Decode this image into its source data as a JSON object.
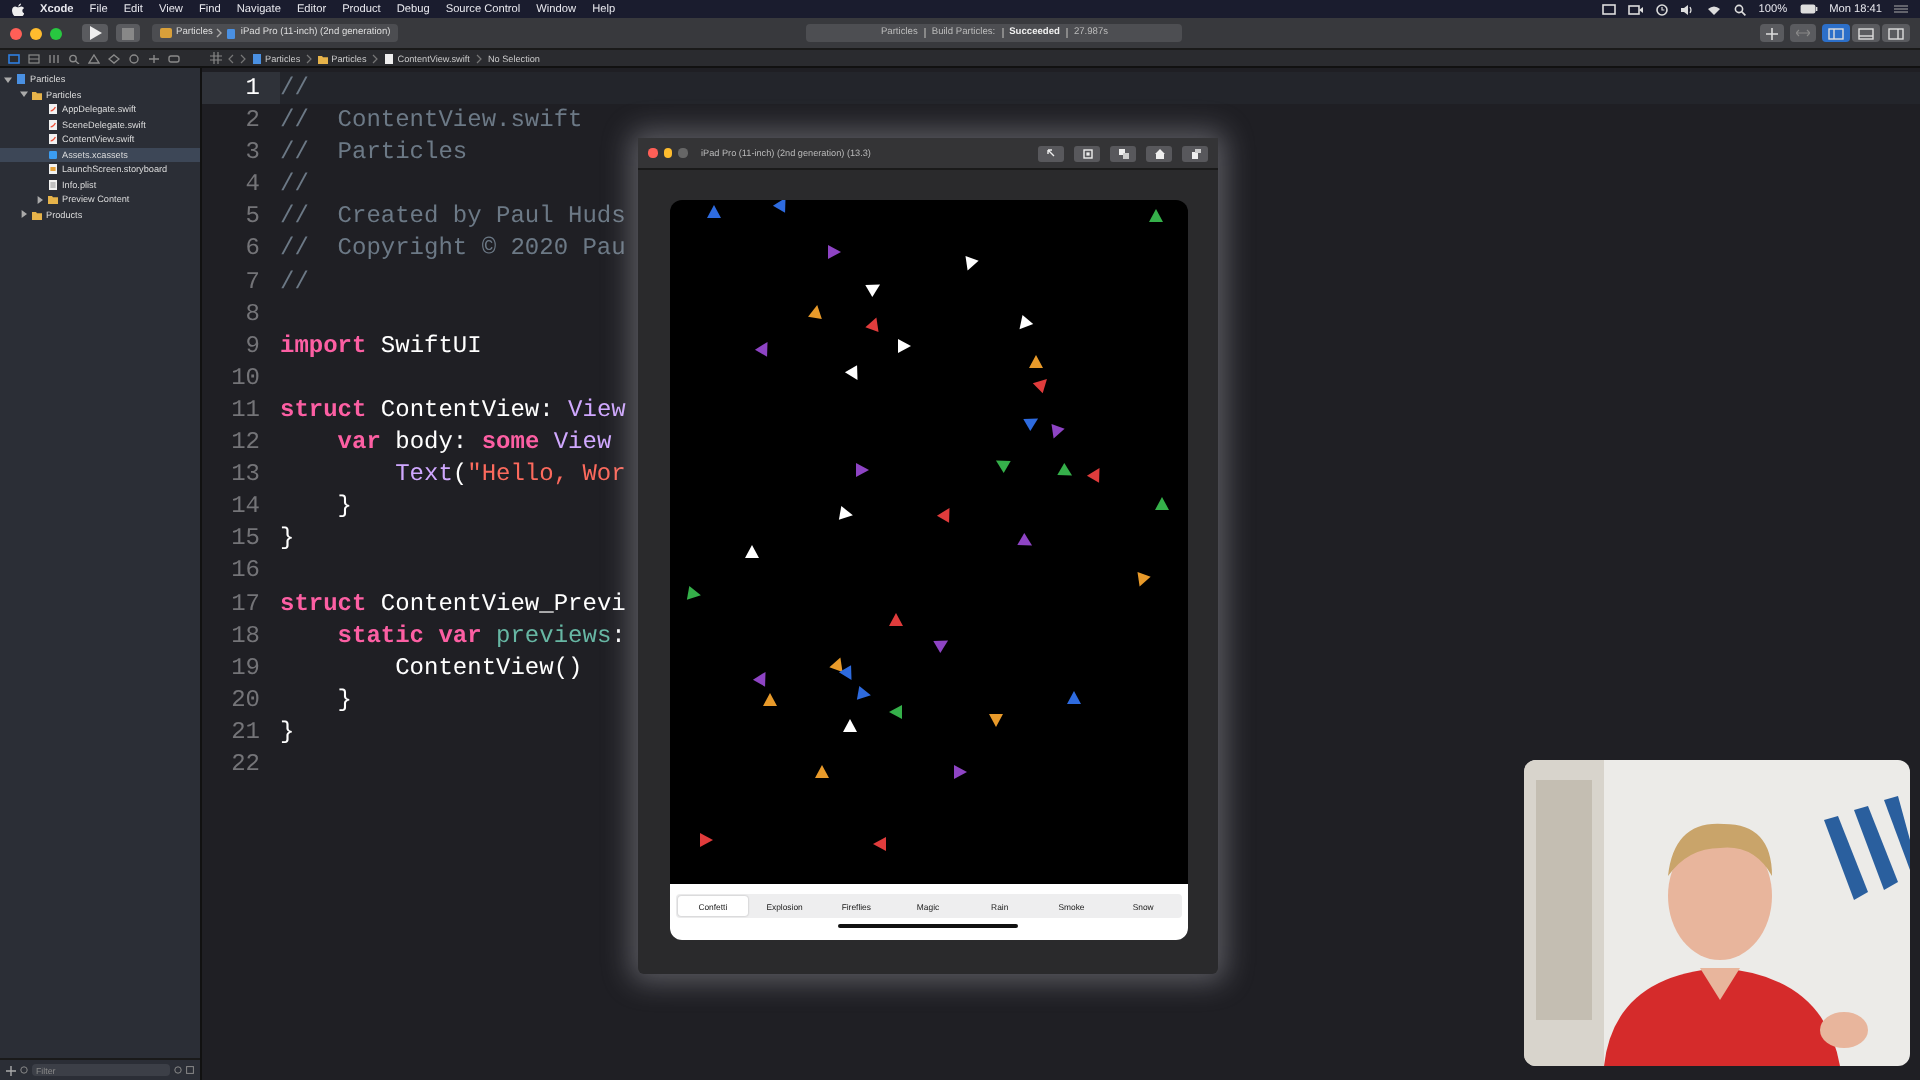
{
  "menu_bar": {
    "items": [
      {
        "label": "Xcode",
        "kind": "app"
      },
      {
        "label": "File",
        "kind": "menu"
      },
      {
        "label": "Edit",
        "kind": "menu"
      },
      {
        "label": "View",
        "kind": "menu"
      },
      {
        "label": "Find",
        "kind": "menu"
      },
      {
        "label": "Navigate",
        "kind": "menu"
      },
      {
        "label": "Editor",
        "kind": "menu"
      },
      {
        "label": "Product",
        "kind": "menu"
      },
      {
        "label": "Debug",
        "kind": "menu"
      },
      {
        "label": "Source Control",
        "kind": "menu"
      },
      {
        "label": "Window",
        "kind": "menu"
      },
      {
        "label": "Help",
        "kind": "menu"
      }
    ],
    "battery": "100%",
    "clock": "Mon 18:41"
  },
  "toolbar": {
    "scheme": "Particles",
    "destination": "iPad Pro (11-inch) (2nd generation)",
    "activity": [
      {
        "text": "Particles",
        "kind": "plain"
      },
      {
        "text": "Build Particles:",
        "kind": "plain"
      },
      {
        "text": "Succeeded",
        "kind": "bold"
      },
      {
        "text": "27.987s",
        "kind": "plain"
      }
    ],
    "panel_toggles": [
      {
        "on": true
      },
      {
        "on": false
      },
      {
        "on": false
      }
    ]
  },
  "navigator_tabs": [
    {
      "selected": true
    },
    {
      "selected": false
    },
    {
      "selected": false
    },
    {
      "selected": false
    },
    {
      "selected": false
    },
    {
      "selected": false
    },
    {
      "selected": false
    },
    {
      "selected": false
    },
    {
      "selected": false
    }
  ],
  "breadcrumb": [
    {
      "label": "Particles",
      "kind": "project"
    },
    {
      "label": "Particles",
      "kind": "folder"
    },
    {
      "label": "ContentView.swift",
      "kind": "swift"
    },
    {
      "label": "No Selection",
      "kind": "plain"
    }
  ],
  "navigator": {
    "items": [
      {
        "label": "Particles",
        "kind": "project",
        "expanded": true,
        "selected": false,
        "children": [
          {
            "label": "Particles",
            "kind": "folder",
            "expanded": true,
            "selected": false,
            "children": [
              {
                "label": "AppDelegate.swift",
                "kind": "swift",
                "selected": false
              },
              {
                "label": "SceneDelegate.swift",
                "kind": "swift",
                "selected": false
              },
              {
                "label": "ContentView.swift",
                "kind": "swift",
                "selected": false
              },
              {
                "label": "Assets.xcassets",
                "kind": "assets",
                "selected": true
              },
              {
                "label": "LaunchScreen.storyboard",
                "kind": "storyboard",
                "selected": false
              },
              {
                "label": "Info.plist",
                "kind": "plist",
                "selected": false
              },
              {
                "label": "Preview Content",
                "kind": "folder",
                "expanded": false,
                "selected": false
              }
            ]
          },
          {
            "label": "Products",
            "kind": "folder",
            "expanded": false,
            "selected": false
          }
        ]
      }
    ],
    "filter": {
      "placeholder": "Filter"
    }
  },
  "editor": {
    "lines": [
      {
        "number": "1",
        "current": true,
        "tokens": [
          {
            "text": "//",
            "kind": "comment"
          }
        ]
      },
      {
        "number": "2",
        "current": false,
        "tokens": [
          {
            "text": "//  ContentView.swift",
            "kind": "comment"
          }
        ]
      },
      {
        "number": "3",
        "current": false,
        "tokens": [
          {
            "text": "//  Particles",
            "kind": "comment"
          }
        ]
      },
      {
        "number": "4",
        "current": false,
        "tokens": [
          {
            "text": "//",
            "kind": "comment"
          }
        ]
      },
      {
        "number": "5",
        "current": false,
        "tokens": [
          {
            "text": "//  Created by Paul Huds",
            "kind": "comment"
          }
        ]
      },
      {
        "number": "6",
        "current": false,
        "tokens": [
          {
            "text": "//  Copyright © 2020 Pau",
            "kind": "comment"
          }
        ]
      },
      {
        "number": "7",
        "current": false,
        "tokens": [
          {
            "text": "//",
            "kind": "comment"
          }
        ]
      },
      {
        "number": "8",
        "current": false
      },
      {
        "number": "9",
        "current": false,
        "tokens": [
          {
            "text": "import",
            "kind": "keyword"
          },
          {
            "text": " SwiftUI",
            "kind": "plain"
          }
        ]
      },
      {
        "number": "10",
        "current": false
      },
      {
        "number": "11",
        "current": false,
        "tokens": [
          {
            "text": "struct",
            "kind": "keyword"
          },
          {
            "text": " ContentView: ",
            "kind": "plain"
          },
          {
            "text": "View",
            "kind": "type"
          }
        ]
      },
      {
        "number": "12",
        "current": false,
        "tokens": [
          {
            "text": "    var",
            "kind": "keyword"
          },
          {
            "text": " body: ",
            "kind": "plain"
          },
          {
            "text": "some",
            "kind": "keyword"
          },
          {
            "text": " View",
            "kind": "type"
          }
        ]
      },
      {
        "number": "13",
        "current": false,
        "tokens": [
          {
            "text": "        Text",
            "kind": "type"
          },
          {
            "text": "(",
            "kind": "plain"
          },
          {
            "text": "\"Hello, Wor",
            "kind": "string"
          }
        ]
      },
      {
        "number": "14",
        "current": false,
        "tokens": [
          {
            "text": "    }",
            "kind": "plain"
          }
        ]
      },
      {
        "number": "15",
        "current": false,
        "tokens": [
          {
            "text": "}",
            "kind": "plain"
          }
        ]
      },
      {
        "number": "16",
        "current": false
      },
      {
        "number": "17",
        "current": false,
        "tokens": [
          {
            "text": "struct",
            "kind": "keyword"
          },
          {
            "text": " ContentView_Previ",
            "kind": "plain"
          }
        ]
      },
      {
        "number": "18",
        "current": false,
        "tokens": [
          {
            "text": "    static",
            "kind": "keyword"
          },
          {
            "text": " var",
            "kind": "keyword"
          },
          {
            "text": " previews",
            "kind": "property"
          },
          {
            "text": ":",
            "kind": "plain"
          }
        ]
      },
      {
        "number": "19",
        "current": false,
        "tokens": [
          {
            "text": "        ContentView()",
            "kind": "plain"
          }
        ]
      },
      {
        "number": "20",
        "current": false,
        "tokens": [
          {
            "text": "    }",
            "kind": "plain"
          }
        ]
      },
      {
        "number": "21",
        "current": false,
        "tokens": [
          {
            "text": "}",
            "kind": "plain"
          }
        ]
      },
      {
        "number": "22",
        "current": false
      }
    ]
  },
  "simulator": {
    "title": "iPad Pro (11-inch) (2nd generation) (13.3)",
    "tabs": [
      {
        "label": "Confetti",
        "selected": true
      },
      {
        "label": "Explosion",
        "selected": false
      },
      {
        "label": "Fireflies",
        "selected": false
      },
      {
        "label": "Magic",
        "selected": false
      },
      {
        "label": "Rain",
        "selected": false
      },
      {
        "label": "Smoke",
        "selected": false
      },
      {
        "label": "Snow",
        "selected": false
      }
    ]
  }
}
